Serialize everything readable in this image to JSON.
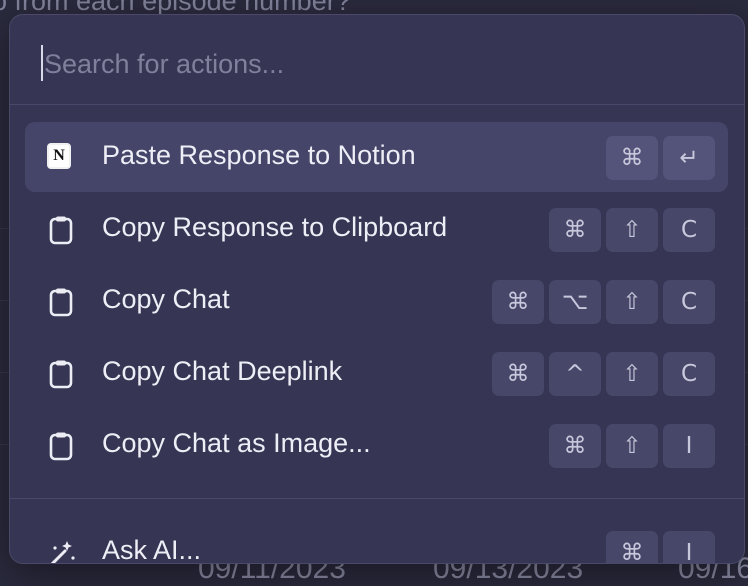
{
  "background": {
    "top_text": "o from each episode number?",
    "dates": [
      "09/11/2023",
      "09/13/2023",
      "09/16"
    ]
  },
  "search": {
    "placeholder": "Search for actions..."
  },
  "actions": [
    {
      "label": "Paste Response to Notion",
      "icon": "notion-icon",
      "keys": [
        "⌘",
        "↵"
      ],
      "selected": true
    },
    {
      "label": "Copy Response to Clipboard",
      "icon": "clipboard-icon",
      "keys": [
        "⌘",
        "⇧",
        "C"
      ]
    },
    {
      "label": "Copy Chat",
      "icon": "clipboard-icon",
      "keys": [
        "⌘",
        "⌥",
        "⇧",
        "C"
      ]
    },
    {
      "label": "Copy Chat Deeplink",
      "icon": "clipboard-icon",
      "keys": [
        "⌘",
        "^",
        "⇧",
        "C"
      ]
    },
    {
      "label": "Copy Chat as Image...",
      "icon": "clipboard-icon",
      "keys": [
        "⌘",
        "⇧",
        "I"
      ]
    }
  ],
  "footer_action": {
    "label": "Ask AI...",
    "icon": "magic-wand-icon",
    "keys": [
      "⌘",
      "I"
    ]
  }
}
